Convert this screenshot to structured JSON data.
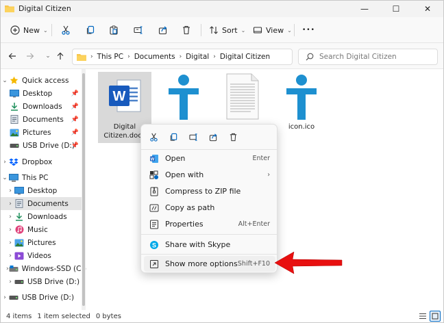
{
  "window": {
    "title": "Digital Citizen",
    "minimize": "—",
    "maximize": "☐",
    "close": "✕"
  },
  "toolbar": {
    "new_label": "New",
    "sort_label": "Sort",
    "view_label": "View",
    "more_label": "•••"
  },
  "address": {
    "crumbs": [
      "This PC",
      "Documents",
      "Digital",
      "Digital Citizen"
    ],
    "search_placeholder": "Search Digital Citizen"
  },
  "sidebar": {
    "items": [
      {
        "label": "Quick access"
      },
      {
        "label": "Desktop"
      },
      {
        "label": "Downloads"
      },
      {
        "label": "Documents"
      },
      {
        "label": "Pictures"
      },
      {
        "label": "USB Drive (D:)"
      },
      {
        "label": "Dropbox"
      },
      {
        "label": "This PC"
      },
      {
        "label": "Desktop"
      },
      {
        "label": "Documents"
      },
      {
        "label": "Downloads"
      },
      {
        "label": "Music"
      },
      {
        "label": "Pictures"
      },
      {
        "label": "Videos"
      },
      {
        "label": "Windows-SSD (C:)"
      },
      {
        "label": "USB Drive (D:)"
      },
      {
        "label": "USB Drive (D:)"
      }
    ]
  },
  "files": [
    {
      "name": "Digital Citizen.docx",
      "line1": "Digital",
      "line2": "Citizen.docx"
    },
    {
      "name": ""
    },
    {
      "name": ""
    },
    {
      "name": "icon.ico"
    }
  ],
  "context_menu": {
    "items": [
      {
        "label": "Open",
        "shortcut": "Enter"
      },
      {
        "label": "Open with",
        "shortcut": "›"
      },
      {
        "label": "Compress to ZIP file",
        "shortcut": ""
      },
      {
        "label": "Copy as path",
        "shortcut": ""
      },
      {
        "label": "Properties",
        "shortcut": "Alt+Enter"
      },
      {
        "label": "Share with Skype",
        "shortcut": ""
      },
      {
        "label": "Show more options",
        "shortcut": "Shift+F10"
      }
    ]
  },
  "status": {
    "count": "4 items",
    "selected": "1 item selected",
    "size": "0 bytes"
  },
  "colors": {
    "accent": "#0067c0",
    "arrow": "#e81010",
    "word_blue": "#185abd",
    "digital_citizen_blue": "#1e90d0",
    "folder_yellow": "#f8c74c"
  }
}
